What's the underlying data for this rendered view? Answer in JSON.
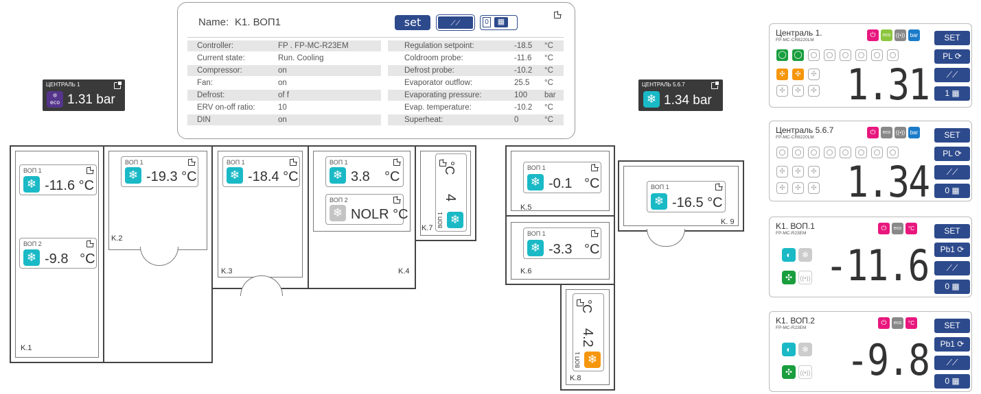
{
  "panel": {
    "name_label": "Name:",
    "name_value": "K1. ВОП1",
    "set_label": "set",
    "chart_label": "⟋⟋",
    "schedule_count": "0",
    "left": [
      {
        "k": "Controller:",
        "v": "FP . FP-MC-R23EM"
      },
      {
        "k": "Current state:",
        "v": "Run. Cooling"
      },
      {
        "k": "Compressor:",
        "v": "on"
      },
      {
        "k": "Fan:",
        "v": "on"
      },
      {
        "k": "Defrost:",
        "v": "of f"
      },
      {
        "k": "ERV on-off ratio:",
        "v": "10"
      },
      {
        "k": "DIN",
        "v": "on"
      }
    ],
    "right": [
      {
        "k": "Regulation setpoint:",
        "v": "-18.5",
        "u": "°C"
      },
      {
        "k": "Coldroom probe:",
        "v": "-11.6",
        "u": "°C"
      },
      {
        "k": "Defrost probe:",
        "v": "-10.2",
        "u": "°C"
      },
      {
        "k": "Evaporator outflow:",
        "v": "25.5",
        "u": "°C"
      },
      {
        "k": "Evaporating pressure:",
        "v": "100",
        "u": "bar"
      },
      {
        "k": "Evap. temperature:",
        "v": "-10.2",
        "u": "°C"
      },
      {
        "k": "Superheat:",
        "v": "0",
        "u": "°C"
      }
    ]
  },
  "centrals": [
    {
      "label": "ЦЕНТРАЛЬ 1",
      "value": "1.31 bar",
      "icon": "eco"
    },
    {
      "label": "ЦЕНТРАЛЬ 5.6.7",
      "value": "1.34 bar",
      "icon": "snow"
    }
  ],
  "evaps": {
    "k1a": {
      "label": "ВОП 1",
      "value": "-11.6 °C"
    },
    "k1b": {
      "label": "ВОП 2",
      "value": "-9.8   °C"
    },
    "k2": {
      "label": "ВОП 1",
      "value": "-19.3 °C"
    },
    "k3": {
      "label": "ВОП 1",
      "value": "-18.4 °C"
    },
    "k4a": {
      "label": "ВОП 1",
      "value": "3.8",
      "unit": "°C"
    },
    "k4b": {
      "label": "ВОП 2",
      "value": "NOLR °C"
    },
    "k5": {
      "label": "ВОП 1",
      "value": "-0.1",
      "unit": "°C"
    },
    "k6": {
      "label": "ВОП 1",
      "value": "-3.3",
      "unit": "°C"
    },
    "k9": {
      "label": "ВОП 1",
      "value": "-16.5 °C"
    },
    "k7": {
      "value": "4",
      "unit": "°C",
      "label": "ВОП 1"
    },
    "k8": {
      "value": "4.2",
      "unit": "°C",
      "label": "ВОП 1"
    }
  },
  "rooms": [
    "K.1",
    "K.2",
    "K.3",
    "K.4",
    "K.5",
    "K.6",
    "K.7",
    "K.8",
    "K. 9"
  ],
  "controllers": [
    {
      "name": "Централь 1.",
      "model": "FP-MC-CR8220LM",
      "big": "1.31",
      "btns": [
        "SET",
        "PL ⟳",
        "⟋⟋",
        "1 ▦"
      ],
      "tags": [
        "eco",
        "bar"
      ]
    },
    {
      "name": "Централь 5.6.7",
      "model": "FP-MC-CR8220LM",
      "big": "1.34",
      "btns": [
        "SET",
        "PL ⟳",
        "⟋⟋",
        "0 ▦"
      ],
      "tags": [
        "eco",
        "bar"
      ]
    },
    {
      "name": "K1. ВОП.1",
      "model": "FP-MC-R23EM",
      "big": "-11.6",
      "btns": [
        "SET",
        "Pb1 ⟳",
        "⟋⟋",
        "0 ▦"
      ],
      "tags": [
        "eco",
        "°C"
      ]
    },
    {
      "name": "K1. ВОП.2",
      "model": "FP-MC-R23EM",
      "big": "-9.8",
      "btns": [
        "SET",
        "Pb1 ⟳",
        "⟋⟋",
        "0 ▦"
      ],
      "tags": [
        "eco",
        "°C"
      ]
    }
  ]
}
